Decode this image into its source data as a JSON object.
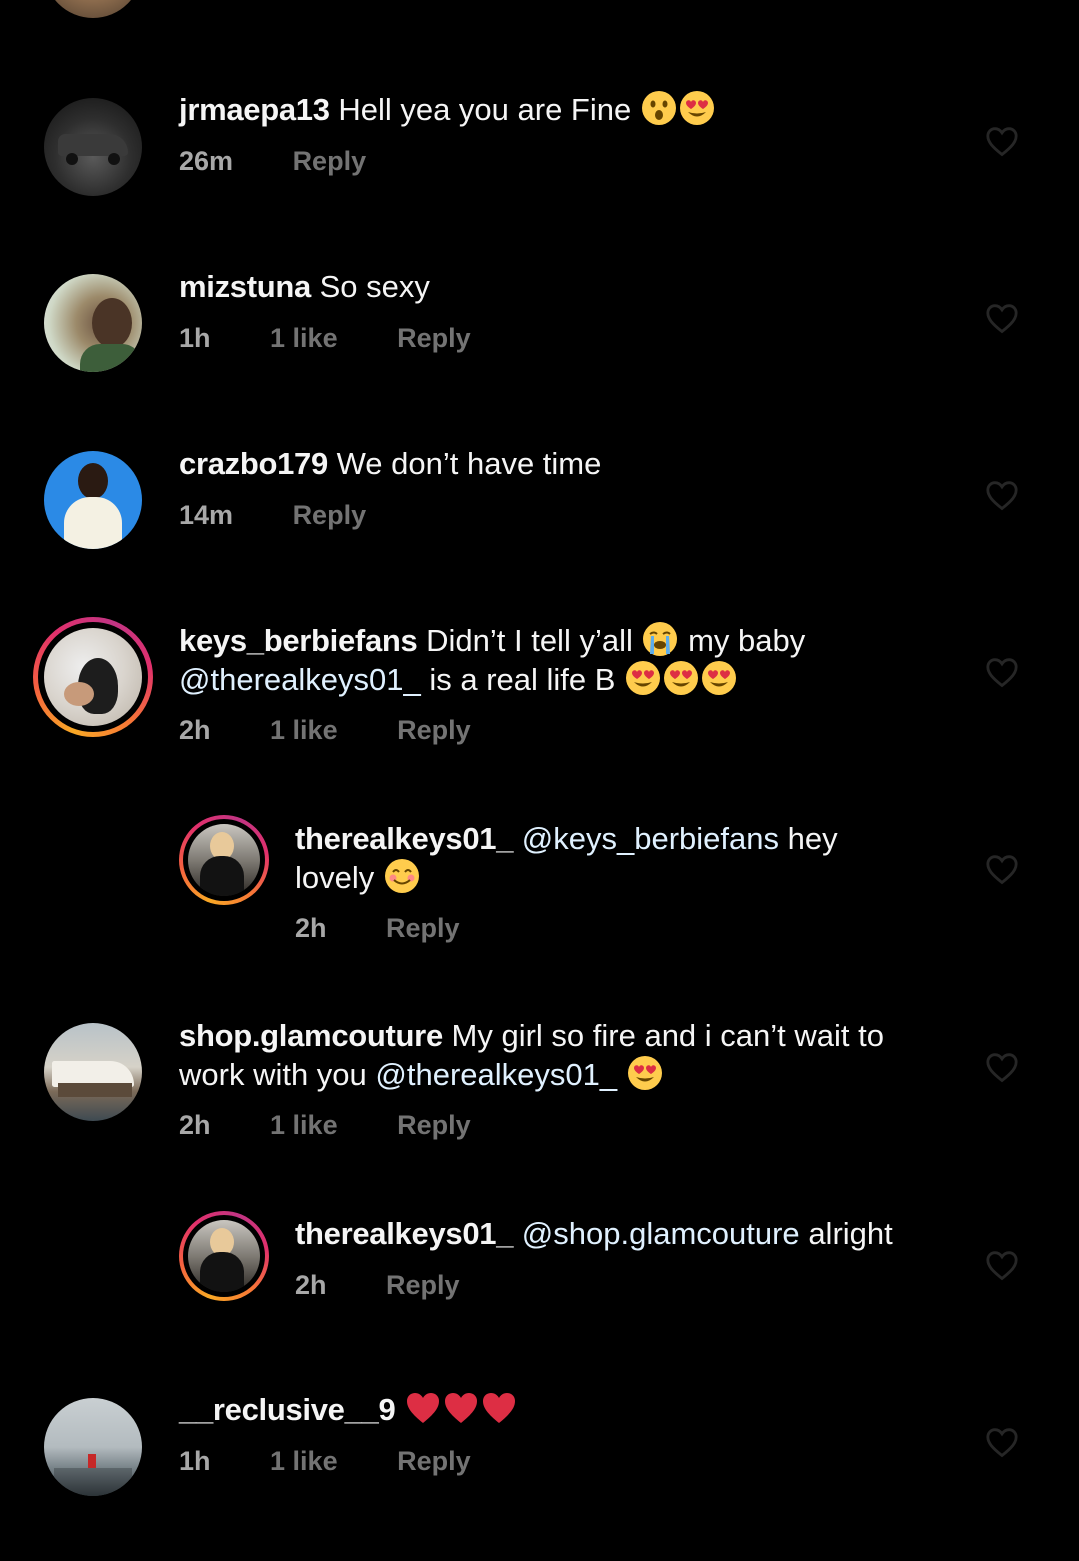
{
  "comments": [
    {
      "username": "jrmaepa13",
      "text": "Hell yea you are Fine",
      "emojis": [
        "astonished-face",
        "heart-eyes-face"
      ],
      "time": "26m",
      "likes": "",
      "reply_label": "Reply"
    },
    {
      "username": "mizstuna",
      "text": "So sexy",
      "emojis": [],
      "time": "1h",
      "likes": "1 like",
      "reply_label": "Reply"
    },
    {
      "username": "crazbo179",
      "text": "We don’t have time",
      "emojis": [],
      "time": "14m",
      "likes": "",
      "reply_label": "Reply"
    },
    {
      "username": "keys_berbiefans",
      "text_before": "Didn’t I tell y’all",
      "text_middle": "my baby",
      "mention": "@therealkeys01_",
      "text_after": "is a real life B",
      "emojis": [
        "loudly-crying-face",
        "heart-eyes-face",
        "heart-eyes-face",
        "heart-eyes-face"
      ],
      "time": "2h",
      "likes": "1 like",
      "reply_label": "Reply"
    },
    {
      "username": "therealkeys01_",
      "mention": "@keys_berbiefans",
      "text_line1": "hey",
      "text_line2": "lovely",
      "emojis": [
        "smiling-face-with-smiling-eyes"
      ],
      "time": "2h",
      "likes": "",
      "reply_label": "Reply"
    },
    {
      "username": "shop.glamcouture",
      "text": "My girl so fire and i can’t wait to work with you",
      "mention": "@therealkeys01_",
      "emojis": [
        "heart-eyes-face"
      ],
      "time": "2h",
      "likes": "1 like",
      "reply_label": "Reply"
    },
    {
      "username": "therealkeys01_",
      "mention": "@shop.glamcouture",
      "text": "alright",
      "emojis": [],
      "time": "2h",
      "likes": "",
      "reply_label": "Reply"
    },
    {
      "username": "__reclusive__9",
      "text": "",
      "emojis": [
        "red-heart",
        "red-heart",
        "red-heart"
      ],
      "time": "1h",
      "likes": "1 like",
      "reply_label": "Reply"
    }
  ],
  "colors": {
    "background": "#000000",
    "primary_text": "#f5f5f5",
    "secondary_text": "#a8a8a8",
    "muted_text": "#737373",
    "mention": "#e0f1ff",
    "story_ring": [
      "#f9a825",
      "#e1306c",
      "#c13584"
    ]
  },
  "icons": {
    "like": "heart-outline-icon"
  }
}
